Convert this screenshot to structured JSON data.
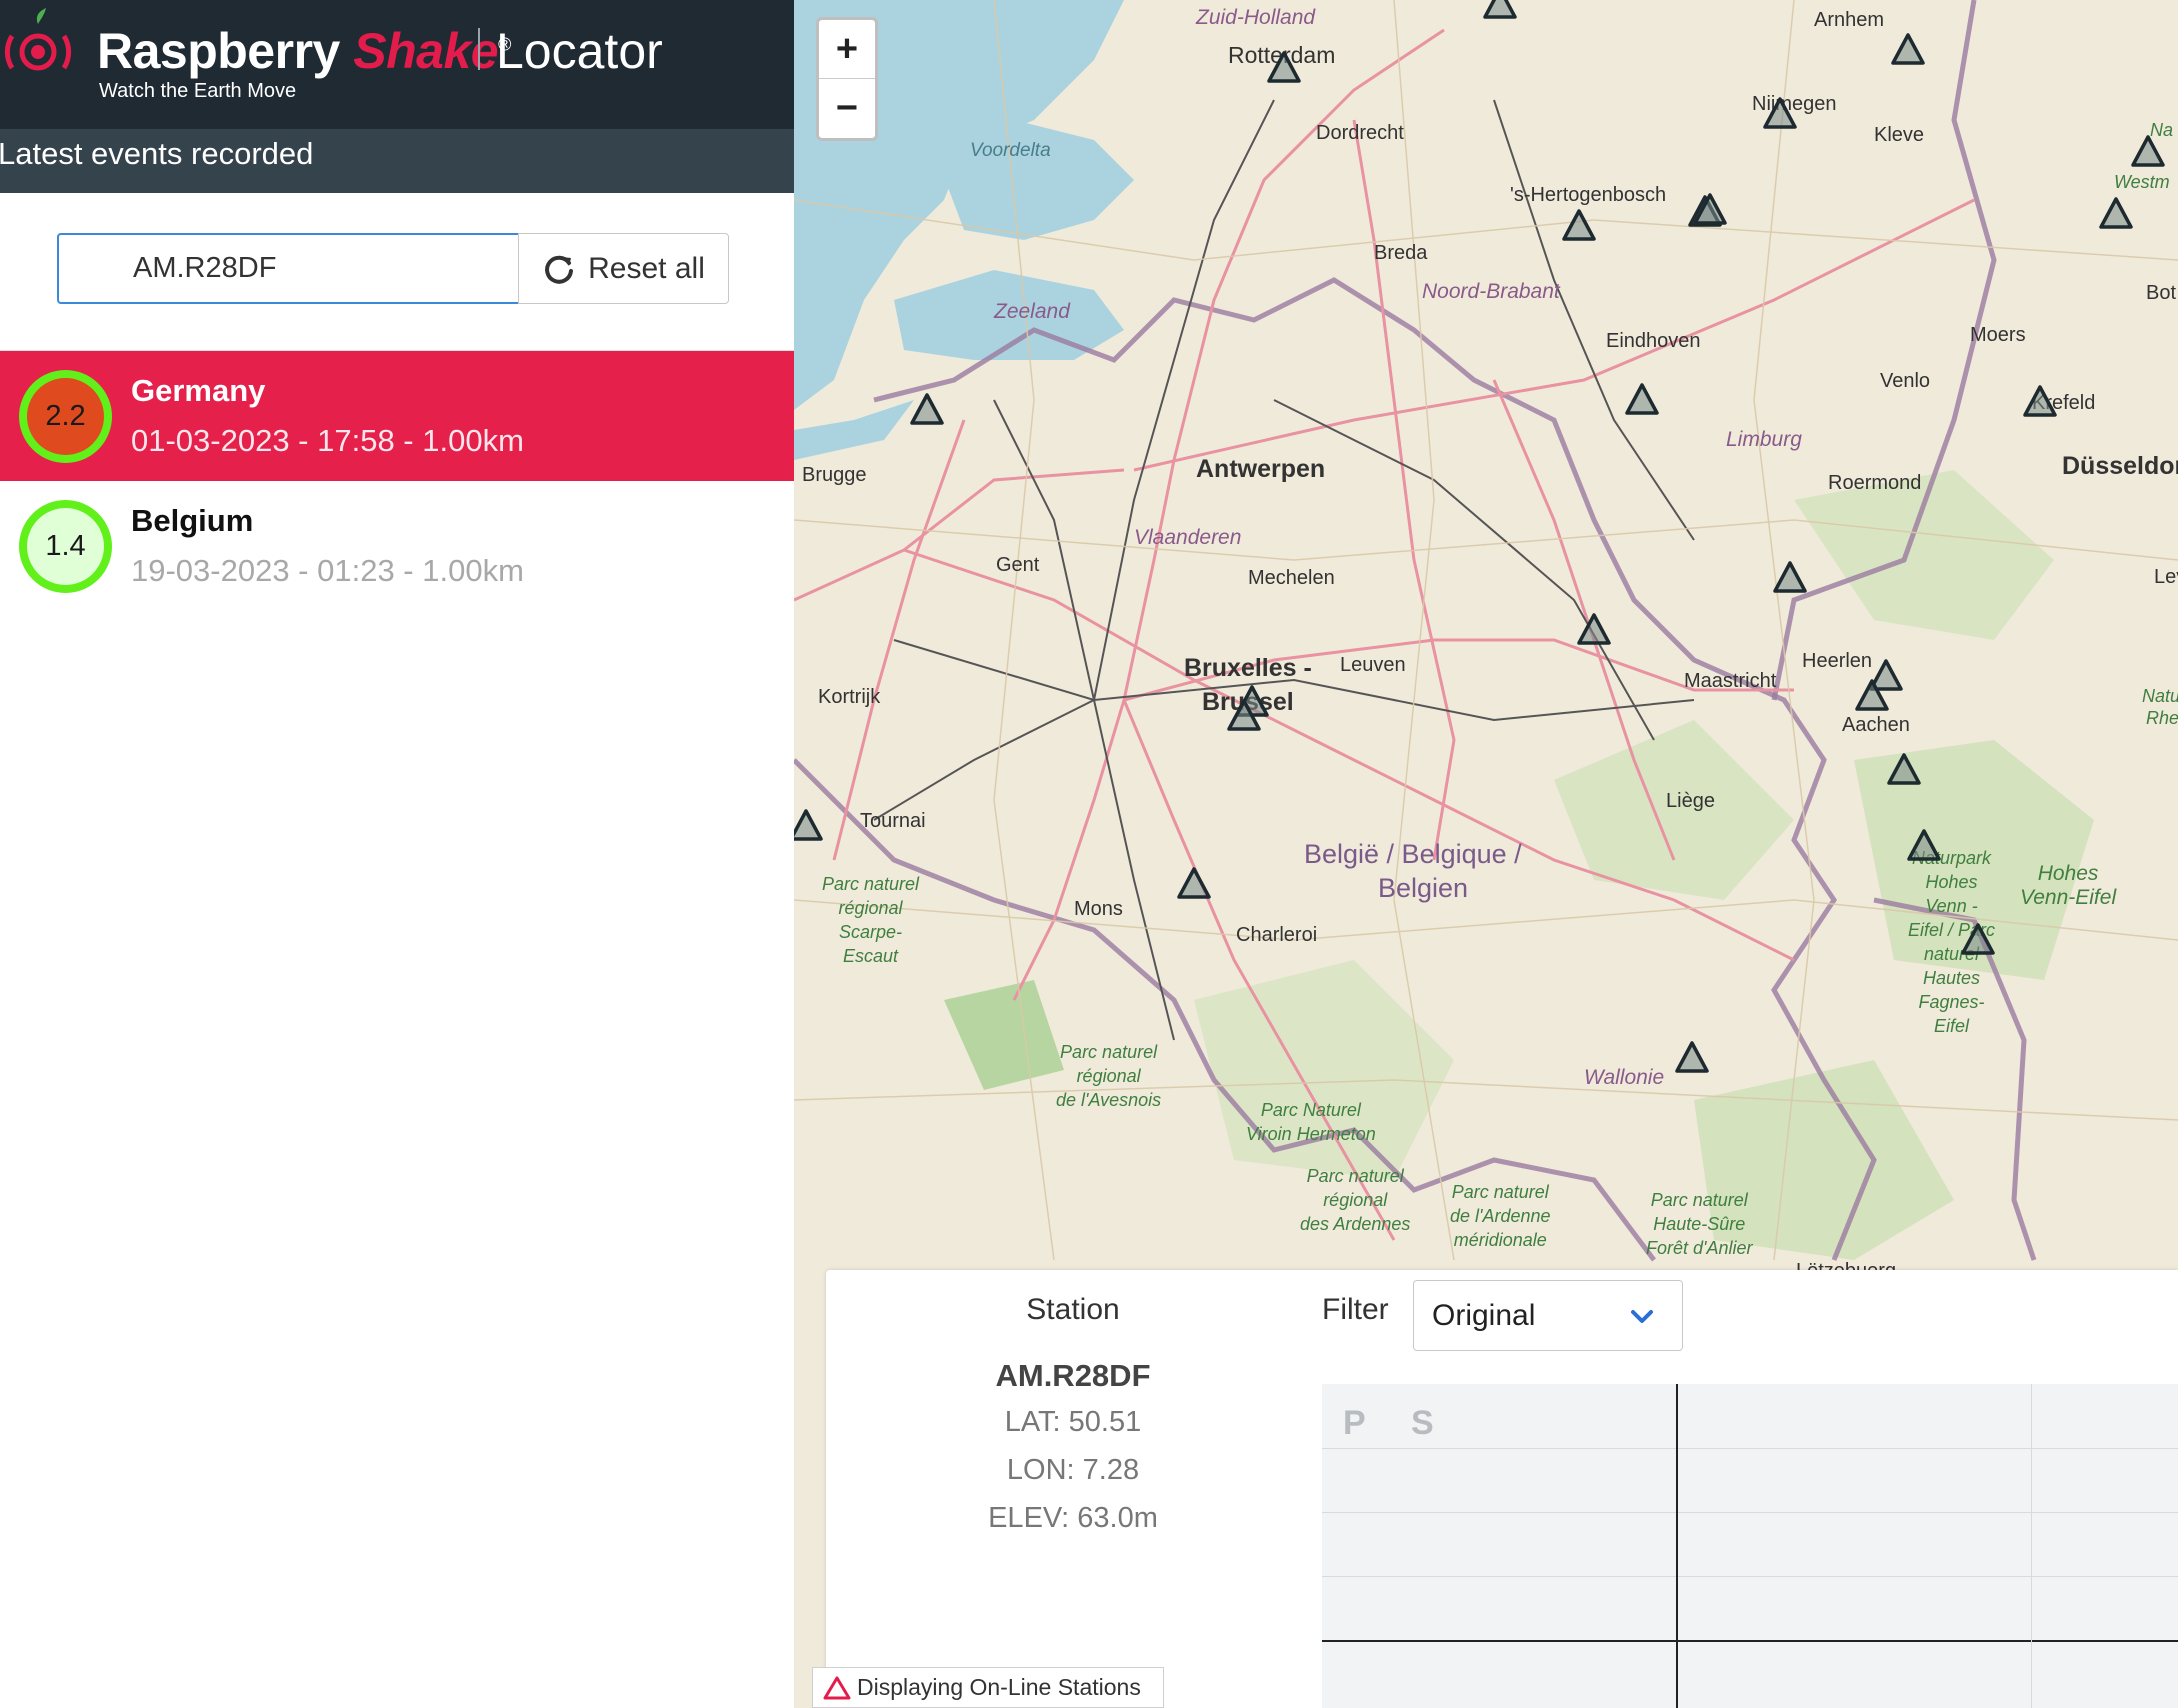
{
  "header": {
    "brand_main": "Raspberry",
    "brand_accent": "Shake",
    "brand_mark": "®",
    "app_name": "Locator",
    "tagline": "Watch the Earth Move",
    "colors": {
      "header_bg": "#1f2a33",
      "accent": "#e31c4c"
    }
  },
  "events_panel": {
    "title": "Latest events recorded",
    "search": {
      "value": "AM.R28DF",
      "placeholder": ""
    },
    "reset_label": "Reset all",
    "events": [
      {
        "magnitude": "2.2",
        "region": "Germany",
        "details": "01-03-2023 - 17:58 - 1.00km",
        "selected": true,
        "mag_color": "#e04a1f"
      },
      {
        "magnitude": "1.4",
        "region": "Belgium",
        "details": "19-03-2023 - 01:23 - 1.00km",
        "selected": false,
        "mag_color": "#e0ffd6"
      }
    ]
  },
  "map": {
    "zoom_in": "+",
    "zoom_out": "−",
    "labels": {
      "rotterdam": "Rotterdam",
      "zuid_holland": "Zuid-Holland",
      "arnhem": "Arnhem",
      "nijmegen": "Nijmegen",
      "kleve": "Kleve",
      "dordrecht": "Dordrecht",
      "voordelta": "Voordelta",
      "hertogenbosch": "'s-Hertogenbosch",
      "breda": "Breda",
      "noord_brabant": "Noord-Brabant",
      "zeeland": "Zeeland",
      "eindhoven": "Eindhoven",
      "moers": "Moers",
      "venlo": "Venlo",
      "krefeld": "Krefeld",
      "duesseldorf": "Düsseldorf",
      "bruges": "Brugge",
      "antwerpen": "Antwerpen",
      "limburg": "Limburg",
      "roermond": "Roermond",
      "vlaanderen": "Vlaanderen",
      "gent": "Gent",
      "mechelen": "Mechelen",
      "bruxelles": "Bruxelles -",
      "brussel": "Brussel",
      "leuven": "Leuven",
      "kortrijk": "Kortrijk",
      "heerlen": "Heerlen",
      "maastricht": "Maastricht",
      "aachen": "Aachen",
      "liege": "Liège",
      "tournai": "Tournai",
      "belgique": "België / Belgique /",
      "belgien": "Belgien",
      "mons": "Mons",
      "charleroi": "Charleroi",
      "wallonie": "Wallonie",
      "westm": "Westm",
      "bot": "Bot",
      "na": "Na",
      "natur": "Natur",
      "rhein": "Rheinl",
      "lev": "Lev",
      "parc_scarpe": "Parc naturel\nrégional\nScarpe-\nEscaut",
      "parc_avesnois": "Parc naturel\nrégional\nde l'Avesnois",
      "parc_viroin": "Parc Naturel\nViroin Hermeton",
      "parc_ardennes": "Parc naturel\nrégional\ndes Ardennes",
      "parc_ardenne_mer": "Parc naturel\nde l'Ardenne\nméridionale",
      "parc_haute_sure": "Parc naturel\nHaute-Sûre\nForêt d'Anlier",
      "naturpark_hohes": "Naturpark\nHohes\nVenn -\nEifel / Parc\nnaturel\nHautes\nFagnes-\nEifel",
      "hohes_venn": "Hohes\nVenn-Eifel",
      "luxembourg": "Lëtzebuerg"
    }
  },
  "station_panel": {
    "heading": "Station",
    "code": "AM.R28DF",
    "lat": "LAT: 50.51",
    "lon": "LON: 7.28",
    "elev": "ELEV: 63.0m",
    "filter_label": "Filter",
    "filter_value": "Original",
    "phase_p": "P",
    "phase_s": "S"
  },
  "legend": {
    "text": "Displaying On-Line Stations"
  }
}
